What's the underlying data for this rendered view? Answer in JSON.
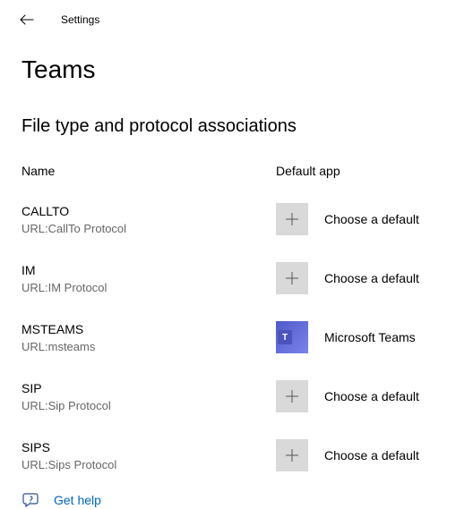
{
  "header": {
    "title": "Settings"
  },
  "page": {
    "title": "Teams",
    "section": "File type and protocol associations"
  },
  "columns": {
    "name": "Name",
    "app": "Default app"
  },
  "rows": [
    {
      "name": "CALLTO",
      "desc": "URL:CallTo Protocol",
      "appType": "plus",
      "appLabel": "Choose a default"
    },
    {
      "name": "IM",
      "desc": "URL:IM Protocol",
      "appType": "plus",
      "appLabel": "Choose a default"
    },
    {
      "name": "MSTEAMS",
      "desc": "URL:msteams",
      "appType": "teams",
      "appLabel": "Microsoft Teams"
    },
    {
      "name": "SIP",
      "desc": "URL:Sip Protocol",
      "appType": "plus",
      "appLabel": "Choose a default"
    },
    {
      "name": "SIPS",
      "desc": "URL:Sips Protocol",
      "appType": "plus",
      "appLabel": "Choose a default"
    }
  ],
  "help": {
    "label": "Get help"
  }
}
